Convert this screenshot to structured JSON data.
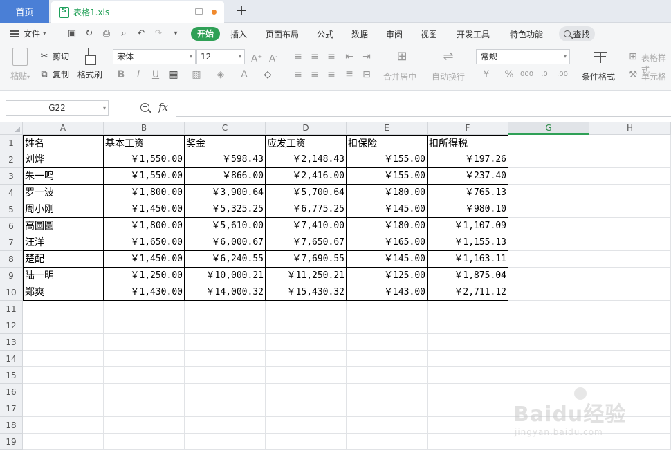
{
  "tabs": {
    "home": "首页",
    "file": "表格1.xls",
    "add": "+"
  },
  "menu": {
    "file": "文件",
    "start": "开始",
    "items": [
      "插入",
      "页面布局",
      "公式",
      "数据",
      "审阅",
      "视图",
      "开发工具",
      "特色功能"
    ],
    "search": "查找"
  },
  "ribbon": {
    "paste": "粘贴",
    "cut": "剪切",
    "copy": "复制",
    "format_painter": "格式刷",
    "font_name": "宋体",
    "font_size": "12",
    "number_format": "常规",
    "merge_center": "合并居中",
    "wrap_text": "自动换行",
    "conditional_format": "条件格式",
    "table_style": "表格样式",
    "cell_format": "单元格"
  },
  "formula_bar": {
    "name_box": "G22",
    "fx": "fx",
    "formula": ""
  },
  "sheet": {
    "columns": [
      "A",
      "B",
      "C",
      "D",
      "E",
      "F",
      "G",
      "H"
    ],
    "selected_column": "G",
    "row_numbers": [
      "1",
      "2",
      "3",
      "4",
      "5",
      "6",
      "7",
      "8",
      "9",
      "10",
      "11",
      "12",
      "13",
      "14",
      "15",
      "16",
      "17",
      "18",
      "19"
    ],
    "headers": [
      "姓名",
      "基本工资",
      "奖金",
      "应发工资",
      "扣保险",
      "扣所得税"
    ],
    "rows": [
      [
        "刘烨",
        "￥1,550.00",
        "￥598.43",
        "￥2,148.43",
        "￥155.00",
        "￥197.26"
      ],
      [
        "朱一鸣",
        "￥1,550.00",
        "￥866.00",
        "￥2,416.00",
        "￥155.00",
        "￥237.40"
      ],
      [
        "罗一波",
        "￥1,800.00",
        "￥3,900.64",
        "￥5,700.64",
        "￥180.00",
        "￥765.13"
      ],
      [
        "周小刚",
        "￥1,450.00",
        "￥5,325.25",
        "￥6,775.25",
        "￥145.00",
        "￥980.10"
      ],
      [
        "高圆圆",
        "￥1,800.00",
        "￥5,610.00",
        "￥7,410.00",
        "￥180.00",
        "￥1,107.09"
      ],
      [
        "汪洋",
        "￥1,650.00",
        "￥6,000.67",
        "￥7,650.67",
        "￥165.00",
        "￥1,155.13"
      ],
      [
        "楚配",
        "￥1,450.00",
        "￥6,240.55",
        "￥7,690.55",
        "￥145.00",
        "￥1,163.11"
      ],
      [
        "陆一明",
        "￥1,250.00",
        "￥10,000.21",
        "￥11,250.21",
        "￥125.00",
        "￥1,875.04"
      ],
      [
        "郑爽",
        "￥1,430.00",
        "￥14,000.32",
        "￥15,430.32",
        "￥143.00",
        "￥2,711.12"
      ]
    ]
  },
  "watermark": {
    "main": "Baidu经验",
    "sub": "jingyan.baidu.com"
  }
}
